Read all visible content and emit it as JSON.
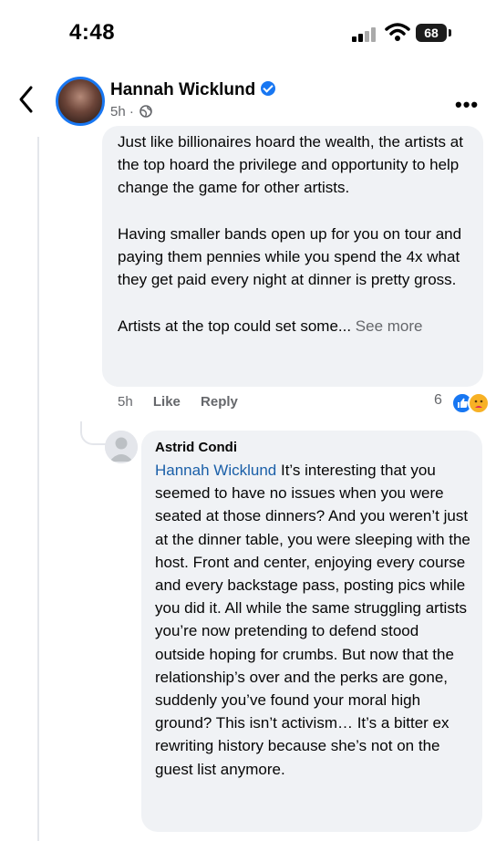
{
  "status_bar": {
    "time": "4:48",
    "battery": "68"
  },
  "header": {
    "name": "Hannah Wicklund",
    "meta": "5h ·"
  },
  "comment1": {
    "paragraph1": "Just like billionaires hoard the wealth, the artists at the top hoard the privilege and opportunity to help change the game for other artists.",
    "paragraph2": "Having smaller bands open up for you on tour and paying them pennies while you spend the 4x what they get paid every night at dinner is pretty gross.",
    "paragraph3": "Artists at the top could set some...",
    "see_more": "See more",
    "time": "5h",
    "like_label": "Like",
    "reply_label": "Reply",
    "reaction_count": "6"
  },
  "comment2": {
    "author": "Astrid Condi",
    "mention": "Hannah Wicklund",
    "text": "It’s interesting that you seemed to have no issues when you were seated at those dinners? And you weren’t just at the dinner table, you were sleeping with the host. Front and center, enjoying every course and every backstage pass, posting pics while you did it. All while the same struggling artists you’re now pretending to defend stood outside hoping for crumbs. But now that the relationship’s over and the perks are gone, suddenly you’ve found your moral high ground? This isn’t activism… It’s a bitter ex rewriting history because she’s not on the guest list anymore."
  },
  "colors": {
    "accent": "#1877f2",
    "bubble": "#f0f2f5",
    "muted": "#65676b",
    "mention": "#1a5fa8"
  }
}
